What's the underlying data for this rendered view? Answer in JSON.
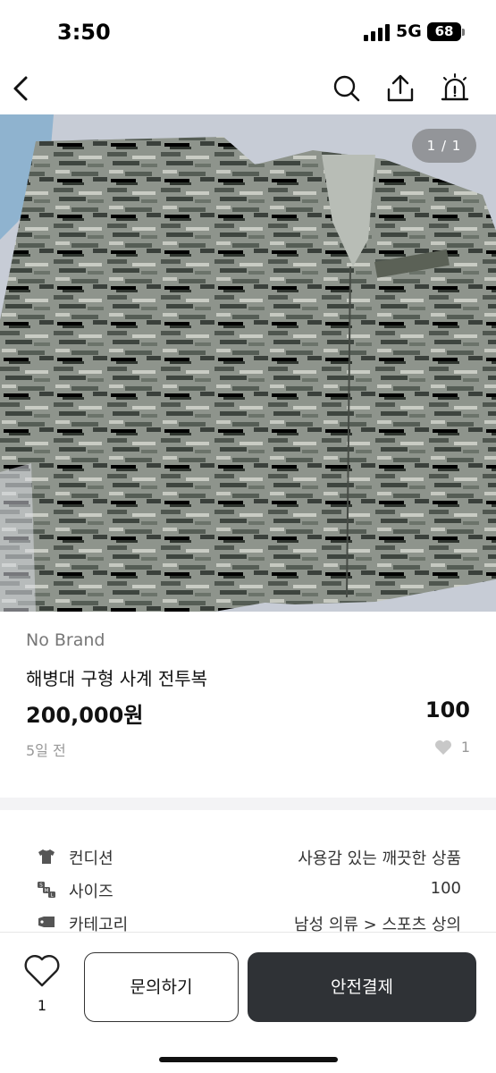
{
  "status_bar": {
    "time": "3:50",
    "network": "5G",
    "battery": "68"
  },
  "nav": {
    "back_icon": "chevron-left-icon",
    "search_icon": "search-icon",
    "share_icon": "share-icon",
    "report_icon": "alarm-siren-icon"
  },
  "photo": {
    "counter": "1 / 1"
  },
  "product": {
    "brand": "No Brand",
    "title": "해병대 구형 사계 전투복",
    "price": "200,000원",
    "size": "100",
    "posted": "5일 전",
    "likes": "1"
  },
  "details": [
    {
      "icon": "shirt-icon",
      "label": "컨디션",
      "value": "사용감 있는 깨끗한 상품"
    },
    {
      "icon": "size-sml-icon",
      "label": "사이즈",
      "value": "100"
    },
    {
      "icon": "tag-icon",
      "label": "카테고리",
      "value": "남성 의류 > 스포츠 상의"
    }
  ],
  "bottom": {
    "favorite_count": "1",
    "inquiry_label": "문의하기",
    "pay_label": "안전결제"
  },
  "colors": {
    "primary_button": "#2f3236",
    "muted_text": "#999999",
    "divider": "#f3f3f5"
  }
}
